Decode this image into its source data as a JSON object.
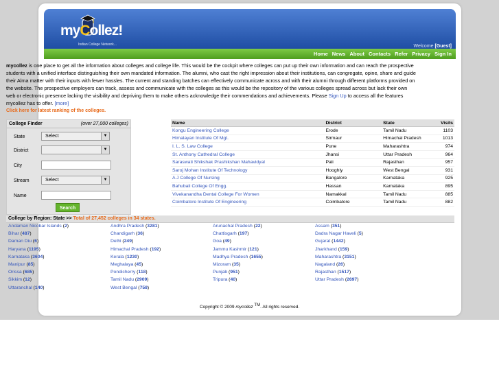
{
  "header": {
    "logo_my": "my",
    "logo_c": "C",
    "logo_rest": "ollez!",
    "tagline": "Indian College Network...",
    "welcome_label": "Welcome",
    "welcome_user": "[Guest]"
  },
  "nav": [
    "Home",
    "News",
    "About",
    "Contacts",
    "Refer",
    "Privacy",
    "Sign In"
  ],
  "intro": {
    "brand": "mycollez",
    "text": " is one place to get all the information about colleges and college life. This would be the cockpit where colleges can put up their own information and can reach the prospective students with a unified interface distinguishing their own mandated information. The alumni, who cast the right impression about their institutions, can congregate, opine, share and guide their Alma matter with their inputs with fewer hassles. The current and standing batches can effectively communicate across and with their alumni through different platforms provided on the website. The prospective employers can track, assess and communicate with the colleges as this would be the repository of the various colleges spread across but lack their own web or electronic presence lacking the visibility and depriving them to make others acknowledge their commendations and achievements. Please ",
    "signup": "Sign Up",
    "text2": " to access all the features mycollez has to offer.",
    "more": "[more]"
  },
  "click_here": "Click here for latest ranking of the colleges.",
  "finder": {
    "title": "College Finder",
    "note": "(over 27,000 colleges)",
    "state_label": "State",
    "state_value": "Select",
    "district_label": "District",
    "district_value": "",
    "city_label": "City",
    "stream_label": "Stream",
    "stream_value": "Select",
    "name_label": "Name",
    "search": "Search"
  },
  "table": {
    "headers": [
      "Name",
      "District",
      "State",
      "Visits"
    ],
    "rows": [
      [
        "Kongu Engineering College",
        "Erode",
        "Tamil Nadu",
        "1103"
      ],
      [
        "Himalayan Institute Of Mgt.",
        "Sirmaur",
        "Himachal Pradesh",
        "1013"
      ],
      [
        "I. L. S. Law College",
        "Pune",
        "Maharashtra",
        "974"
      ],
      [
        "St. Anthony Cathedral College",
        "Jhansi",
        "Uttar Pradesh",
        "964"
      ],
      [
        "Saraswati Shikshak Prashikshan Mahavidyal",
        "Pali",
        "Rajasthan",
        "957"
      ],
      [
        "Saroj Mohan Institute Of Technology",
        "Hooghly",
        "West Bengal",
        "931"
      ],
      [
        "A J College Of Nursing",
        "Bangalore",
        "Karnataka",
        "925"
      ],
      [
        "Bahubali College Of Engg.",
        "Hassan",
        "Karnataka",
        "895"
      ],
      [
        "Vivekanandha Dental College For Women",
        "Namakkal",
        "Tamil Nadu",
        "885"
      ],
      [
        "Coimbatore Institute Of Engineering",
        "Coimbatore",
        "Tamil Nadu",
        "882"
      ]
    ]
  },
  "region": {
    "title": "College by Region:",
    "crumb": "State  >>",
    "total": "Total of 27,452 colleges in 34 states.",
    "states": [
      [
        "Andaman Nicobar Islands",
        "2"
      ],
      [
        "Andhra Pradesh",
        "3281"
      ],
      [
        "Arunachal Pradesh",
        "22"
      ],
      [
        "Assam",
        "351"
      ],
      [
        "Bihar",
        "487"
      ],
      [
        "Chandigarh",
        "36"
      ],
      [
        "Chattisgarh",
        "197"
      ],
      [
        "Dadra Nagar Haveli",
        "5"
      ],
      [
        "Daman Diu",
        "6"
      ],
      [
        "Delhi",
        "249"
      ],
      [
        "Goa",
        "49"
      ],
      [
        "Gujarat",
        "1442"
      ],
      [
        "Haryana",
        "1195"
      ],
      [
        "Himachal Pradesh",
        "192"
      ],
      [
        "Jammu Kashmir",
        "121"
      ],
      [
        "Jharkhand",
        "159"
      ],
      [
        "Karnataka",
        "3604"
      ],
      [
        "Kerala",
        "1230"
      ],
      [
        "Madhya Pradesh",
        "1655"
      ],
      [
        "Maharashtra",
        "3151"
      ],
      [
        "Manipur",
        "85"
      ],
      [
        "Meghalaya",
        "45"
      ],
      [
        "Mizoram",
        "35"
      ],
      [
        "Nagaland",
        "26"
      ],
      [
        "Orissa",
        "685"
      ],
      [
        "Pondicherry",
        "118"
      ],
      [
        "Punjab",
        "951"
      ],
      [
        "Rajasthan",
        "1517"
      ],
      [
        "Sikkim",
        "12"
      ],
      [
        "Tamil Nadu",
        "2909"
      ],
      [
        "Tripura",
        "40"
      ],
      [
        "Uttar Pradesh",
        "2697"
      ],
      [
        "Uttaranchal",
        "140"
      ],
      [
        "West Bengal",
        "758"
      ]
    ]
  },
  "footer": {
    "pre": "Copyright © 2009 ",
    "brand": "mycollez",
    "tm": "TM",
    "post": ". All rights reserved."
  }
}
